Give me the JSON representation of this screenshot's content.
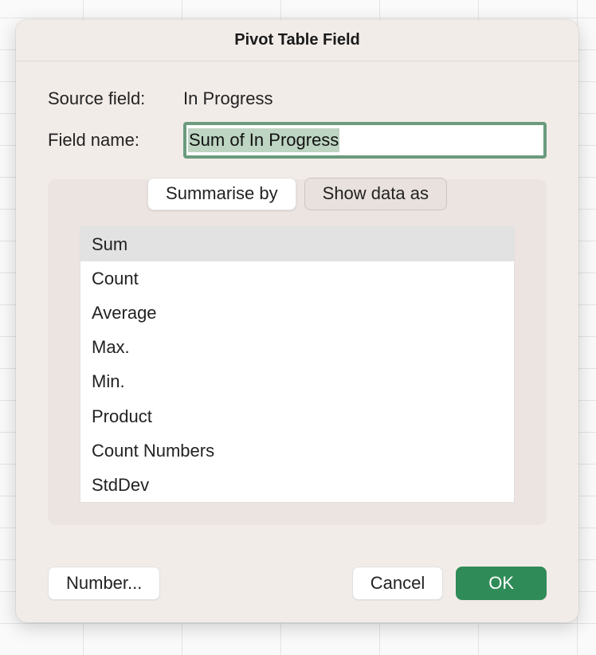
{
  "dialog": {
    "title": "Pivot Table Field",
    "source_field_label": "Source field:",
    "source_field_value": "In Progress",
    "field_name_label": "Field name:",
    "field_name_value": "Sum of In Progress",
    "tabs": [
      {
        "label": "Summarise by",
        "active": true
      },
      {
        "label": "Show data as",
        "active": false
      }
    ],
    "functions": [
      "Sum",
      "Count",
      "Average",
      "Max.",
      "Min.",
      "Product",
      "Count Numbers",
      "StdDev"
    ],
    "selected_function_index": 0,
    "buttons": {
      "number": "Number...",
      "cancel": "Cancel",
      "ok": "OK"
    }
  }
}
